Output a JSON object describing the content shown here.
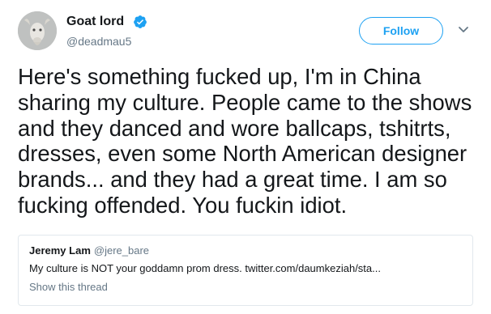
{
  "author": {
    "display_name": "Goat lord",
    "handle": "@deadmau5",
    "verified_icon": "verified-badge-icon",
    "avatar_icon": "goat-avatar"
  },
  "actions": {
    "follow_label": "Follow",
    "menu_icon": "chevron-down-icon"
  },
  "tweet": {
    "text": "Here's something fucked up, I'm in China\nsharing my culture. People came to the shows\nand they danced and wore ballcaps, tshitrts,\ndresses, even some North American designer\nbrands...  and they had a great time. I am so\nfucking offended. You fuckin idiot."
  },
  "quoted_tweet": {
    "name": "Jeremy Lam",
    "handle": "@jere_bare",
    "text": "My culture is NOT your goddamn prom dress. twitter.com/daumkeziah/sta...",
    "show_thread_label": "Show this thread"
  },
  "colors": {
    "accent": "#1da1f2",
    "text_primary": "#14171a",
    "text_secondary": "#657786",
    "border": "#e1e8ed"
  }
}
